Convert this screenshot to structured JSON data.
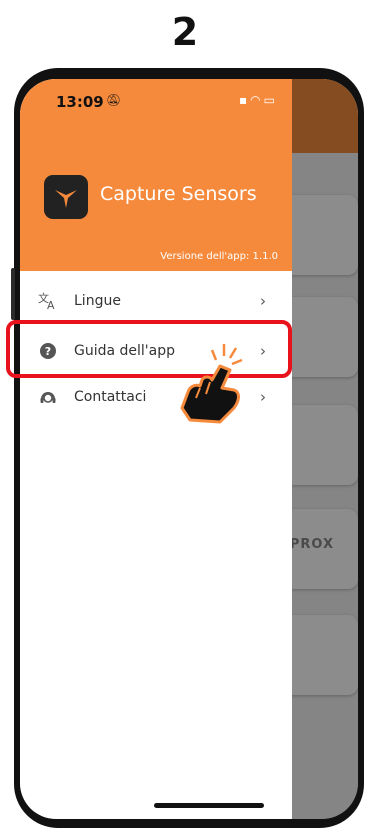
{
  "step": {
    "number": "2"
  },
  "status_bar": {
    "time": "13:09"
  },
  "drawer": {
    "app_name": "Capture Sensors",
    "version": "Versione dell'app: 1.1.0",
    "items": [
      {
        "label": "Lingue",
        "icon": "translate-icon"
      },
      {
        "label": "Guida dell'app",
        "icon": "help-icon"
      },
      {
        "label": "Contattaci",
        "icon": "support-agent-icon"
      }
    ]
  },
  "background": {
    "card_text": "PROX"
  },
  "colors": {
    "accent": "#f58a3c",
    "highlight": "#e8121d"
  }
}
